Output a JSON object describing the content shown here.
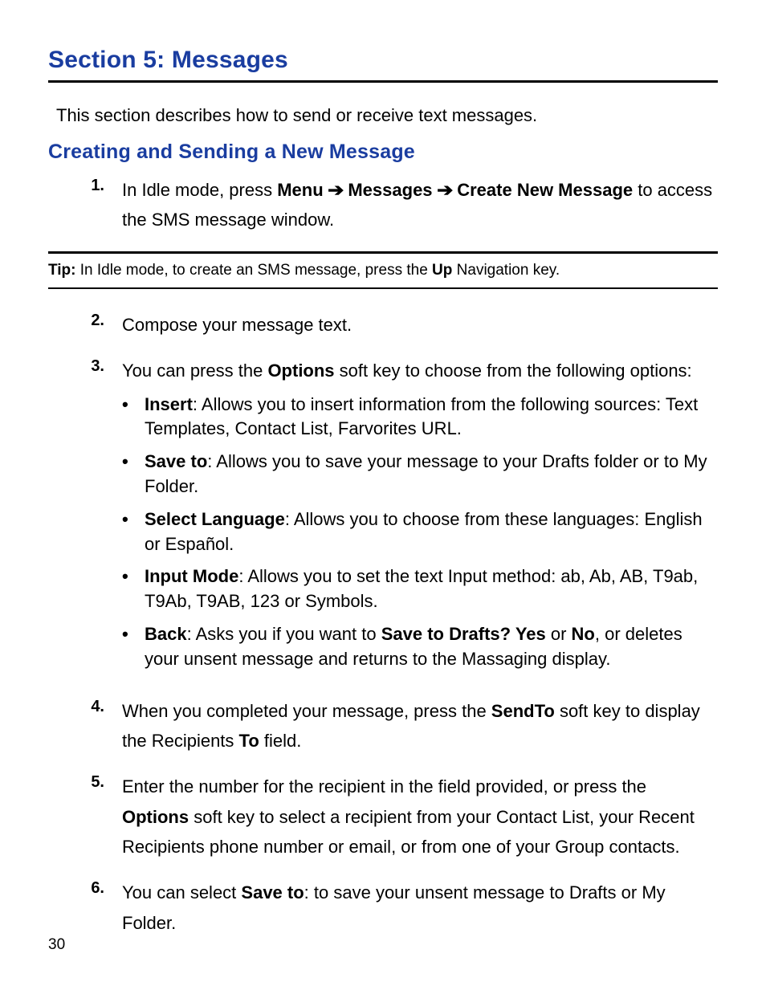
{
  "section_title": "Section 5: Messages",
  "intro": "This section describes how to send or receive text messages.",
  "subheading": "Creating and Sending a New Message",
  "steps": {
    "s1": {
      "num": "1.",
      "pre": "In Idle mode, press ",
      "menu": "Menu",
      "arrow": "➔",
      "messages": "Messages",
      "create": "Create New Message",
      "post": " to access the SMS message window."
    },
    "tip": {
      "label": "Tip:",
      "pre": "  In Idle mode, to create an SMS message, press the ",
      "up": "Up",
      "post": " Navigation key."
    },
    "s2": {
      "num": "2.",
      "text": "Compose your message text."
    },
    "s3": {
      "num": "3.",
      "pre": "You can press the ",
      "options": "Options",
      "post": " soft key to choose from the following options:",
      "bullets": {
        "b1": {
          "label": "Insert",
          "text": ": Allows you to insert information from the following sources: Text Templates, Contact List, Farvorites URL."
        },
        "b2": {
          "label": "Save to",
          "text": ": Allows you to save your message to your Drafts folder or to My Folder."
        },
        "b3": {
          "label": "Select Language",
          "text": ": Allows you to choose from these languages: English or Español."
        },
        "b4": {
          "label": "Input Mode",
          "text": ": Allows you to set the text Input method: ab, Ab, AB, T9ab, T9Ab, T9AB, 123 or Symbols."
        },
        "b5": {
          "label": "Back",
          "pre": ": Asks you if you want to ",
          "save": "Save to Drafts? Yes",
          "or": " or ",
          "no": "No",
          "post": ", or deletes your unsent message and returns to the Massaging display."
        }
      }
    },
    "s4": {
      "num": "4.",
      "pre": "When you completed your message, press the ",
      "sendto": "SendTo",
      "mid": " soft key to display the Recipients ",
      "to": "To",
      "post": " field."
    },
    "s5": {
      "num": "5.",
      "pre": "Enter the number for the recipient in the field provided, or press the ",
      "options": "Options",
      "post": " soft key to select a recipient from your Contact List, your Recent Recipients phone number or email, or from one of your Group contacts."
    },
    "s6": {
      "num": "6.",
      "pre": "You can select ",
      "saveto": "Save to",
      "post": ": to save your unsent message to Drafts or My Folder."
    }
  },
  "page_number": "30"
}
